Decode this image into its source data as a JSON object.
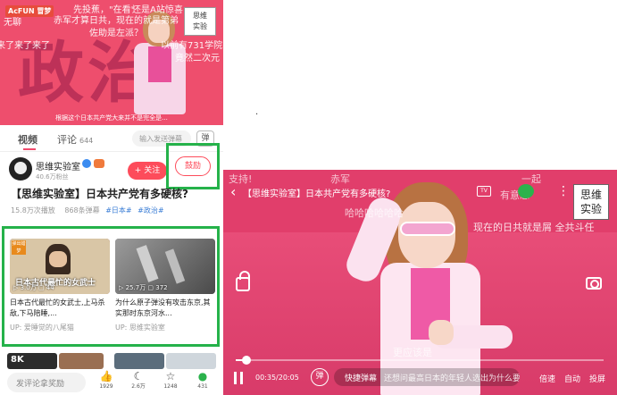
{
  "left": {
    "top_video": {
      "logo": "AcFUN 冒梦",
      "big_word": "政治室",
      "watermark_line1": "思维",
      "watermark_line2": "实验",
      "subtitle": "根据这个日本共产党大来并不是完全是...",
      "danmaku": [
        "先投蕉，\"在看\"",
        "还是A站惊喜",
        "无聊",
        "赤军才算日共，现在的就是第弟",
        "佐助是左派？",
        "来了来了来了",
        "以前有731学院",
        "竟然二次元"
      ]
    },
    "tabs": {
      "video": "视频",
      "comments": "评论",
      "comments_count": "644",
      "danmaku_placeholder": "输入发送弹幕",
      "danmaku_toggle": "弹"
    },
    "uploader": {
      "name": "思维实验室",
      "followers": "40.6万粉丝",
      "follow_label": "+ 关注",
      "cheer_label": "鼓励"
    },
    "video": {
      "title": "【思维实验室】日本共产党有多硬核?",
      "plays": "15.8万次播放",
      "danmaku_count": "868条弹幕",
      "tags": [
        "#日本#",
        "#政治#"
      ]
    },
    "recommendations": [
      {
        "thumb_overlay": "日本古代最忙的女武士",
        "thumb_tag": "弹出蜡梦",
        "stats": "▷ 3.0万  ▢ 44",
        "title": "日本古代最忙的女武士,上马杀敌,下马陪睡,...",
        "uploader": "UP: 爱睡觉的八尾猫"
      },
      {
        "thumb_overlay": "",
        "stats": "▷ 25.7万  ▢ 372",
        "title": "为什么原子弹没有攻击东京,其实那时东京河水...",
        "uploader": "UP: 思维实验室"
      }
    ],
    "more_thumb_label": "8K",
    "bottom_bar": {
      "comment_placeholder": "发评论拿奖励",
      "actions": [
        {
          "name": "like",
          "icon": "thumb-up-icon",
          "count": "1929"
        },
        {
          "name": "coin",
          "icon": "banana-icon",
          "count": "2.6万"
        },
        {
          "name": "favorite",
          "icon": "star-icon",
          "count": "1248"
        },
        {
          "name": "share",
          "icon": "wechat-icon",
          "count": "431"
        }
      ]
    }
  },
  "player": {
    "title": "【思维实验室】日本共产党有多硬核?",
    "watermark_line1": "思维",
    "watermark_line2": "实验",
    "danmaku": [
      "支持!",
      "赤军",
      "一起",
      "有意思",
      "哈哈哈哈哈哈",
      "现在的日共就是屑 全共斗任",
      "更应该是"
    ],
    "time": "00:35/20:05",
    "progress_fraction": 0.029,
    "danmaku_switch": "弹",
    "quick_danmaku": "快捷弹幕",
    "quick_danmaku_sub": "还想问最高日本的年轻人选出为什么要搞娱乐的吗?",
    "speed": "倍速",
    "quality": "自动",
    "cast": "投屏",
    "tv_icon_text": "TV"
  }
}
